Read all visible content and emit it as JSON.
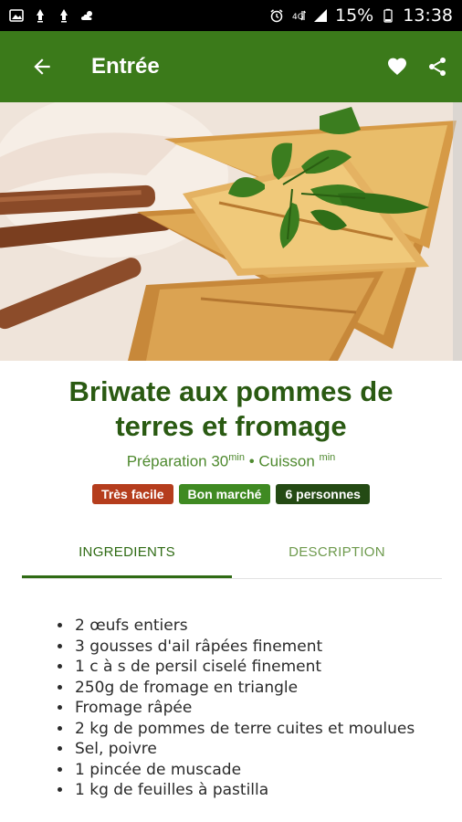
{
  "status_bar": {
    "battery": "15%",
    "time": "13:38",
    "left_icons": [
      "gallery-icon",
      "notification-icon",
      "notification-icon",
      "cloud-sun-icon"
    ],
    "right_icons": [
      "alarm-icon",
      "data-4g-icon",
      "signal-icon",
      "battery-icon"
    ]
  },
  "app_bar": {
    "title": "Entrée",
    "back_icon": "arrow-left-icon",
    "favorite_icon": "heart-icon",
    "share_icon": "share-icon",
    "color": "#3b7a1a"
  },
  "recipe": {
    "title_line1": "Briwate aux pommes de",
    "title_line2": "terres et fromage",
    "prep_label": "Préparation 30",
    "prep_unit": "min",
    "separator": " • ",
    "cook_label": "Cuisson ",
    "cook_unit": "min",
    "badges": [
      {
        "label": "Très facile",
        "color": "#b53d1d"
      },
      {
        "label": "Bon marché",
        "color": "#3f8a22"
      },
      {
        "label": "6 personnes",
        "color": "#244a14"
      }
    ]
  },
  "tabs": [
    {
      "label": "INGREDIENTS",
      "active": true
    },
    {
      "label": "DESCRIPTION",
      "active": false
    }
  ],
  "ingredients": [
    "2 œufs entiers",
    "3 gousses d'ail râpées finement",
    "1 c à s de persil ciselé finement",
    "250g de fromage en triangle",
    "Fromage râpée",
    "2 kg de pommes de terre cuites et moulues",
    "Sel, poivre",
    "1 pincée de muscade",
    "1 kg de feuilles à pastilla"
  ]
}
